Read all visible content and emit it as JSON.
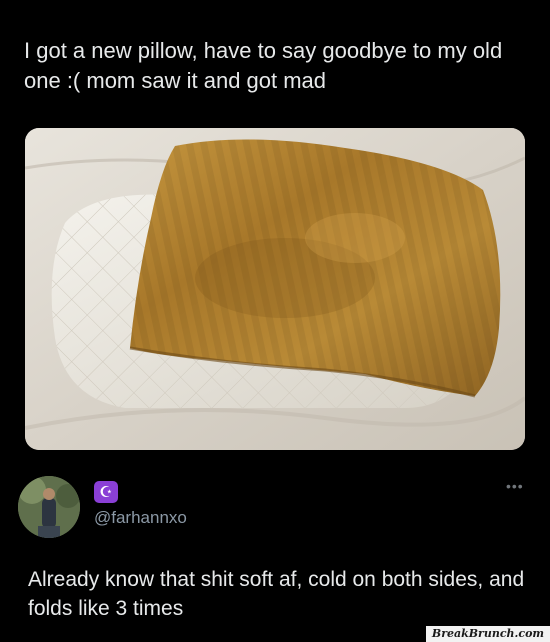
{
  "post": {
    "text": "I got a new pillow, have to say goodbye to my old one :( mom saw it and got mad"
  },
  "reply": {
    "badge_icon": "☪",
    "handle": "@farhannxo",
    "text": "Already know that shit soft af, cold on both sides, and folds like 3 times",
    "more_label": "•••"
  },
  "watermark": {
    "text": "BreakBrunch.com"
  },
  "colors": {
    "background": "#000000",
    "text": "#e7e9ea",
    "secondary_text": "#8b98a5",
    "badge": "#8a3fd6"
  }
}
